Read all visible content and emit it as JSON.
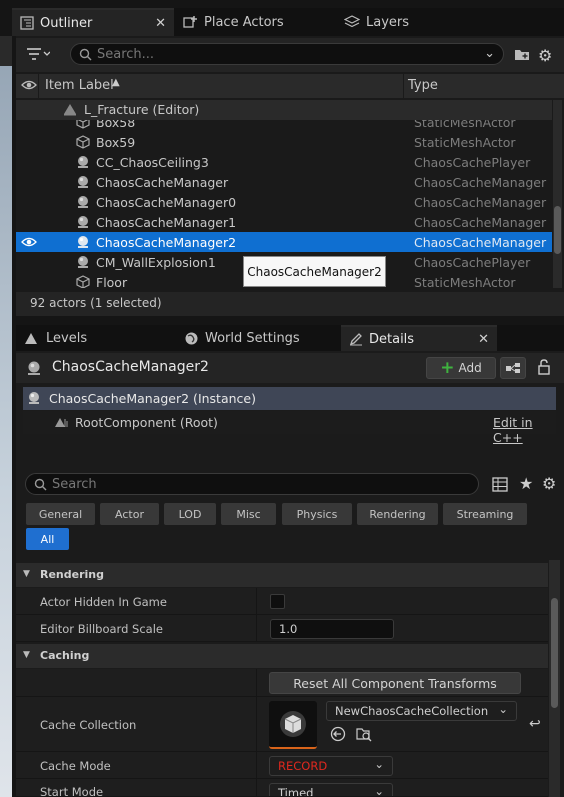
{
  "tabs": [
    {
      "label": "Outliner",
      "active": true,
      "closable": true
    },
    {
      "label": "Place Actors"
    },
    {
      "label": "Layers"
    }
  ],
  "outliner": {
    "search_placeholder": "Search...",
    "col_label": "Item Label",
    "col_type": "Type",
    "folder": "L_Fracture (Editor)",
    "rows": [
      {
        "label": "Box58",
        "type": "StaticMeshActor",
        "icon": "mesh-icon"
      },
      {
        "label": "Box59",
        "type": "StaticMeshActor",
        "icon": "mesh-icon"
      },
      {
        "label": "CC_ChaosCeiling3",
        "type": "ChaosCachePlayer",
        "icon": "actor-icon"
      },
      {
        "label": "ChaosCacheManager",
        "type": "ChaosCacheManager",
        "icon": "actor-icon"
      },
      {
        "label": "ChaosCacheManager0",
        "type": "ChaosCacheManager",
        "icon": "actor-icon"
      },
      {
        "label": "ChaosCacheManager1",
        "type": "ChaosCacheManager",
        "icon": "actor-icon"
      },
      {
        "label": "ChaosCacheManager2",
        "type": "ChaosCacheManager",
        "icon": "actor-icon",
        "selected": true
      },
      {
        "label": "CM_WallExplosion1",
        "type": "ChaosCachePlayer",
        "icon": "actor-icon"
      },
      {
        "label": "Floor",
        "type": "StaticMeshActor",
        "icon": "mesh-icon"
      }
    ],
    "tooltip": "ChaosCacheManager2",
    "status": "92 actors (1 selected)"
  },
  "subtabs": [
    {
      "label": "Levels"
    },
    {
      "label": "World Settings"
    },
    {
      "label": "Details",
      "active": true
    }
  ],
  "details": {
    "actor_name": "ChaosCacheManager2",
    "add_label": "Add",
    "instance_label": "ChaosCacheManager2 (Instance)",
    "root_component": "RootComponent (Root)",
    "edit_cpp": "Edit in C++",
    "search_placeholder": "Search",
    "categories": [
      "General",
      "Actor",
      "LOD",
      "Misc",
      "Physics",
      "Rendering",
      "Streaming",
      "All"
    ],
    "active_category": "All",
    "sections": {
      "rendering": "Rendering",
      "caching": "Caching"
    },
    "props": {
      "hidden_label": "Actor Hidden In Game",
      "billboard_label": "Editor Billboard Scale",
      "billboard_value": "1.0",
      "reset_label": "Reset All Component Transforms",
      "collection_label": "Cache Collection",
      "collection_value": "NewChaosCacheCollection",
      "mode_label": "Cache Mode",
      "mode_value": "RECORD",
      "start_label": "Start Mode",
      "start_value": "Timed"
    }
  },
  "colors": {
    "selection": "#0f6fd1",
    "accent_all": "#1f6fd0",
    "record_red": "#e0281e",
    "add_green": "#3fb33f"
  }
}
